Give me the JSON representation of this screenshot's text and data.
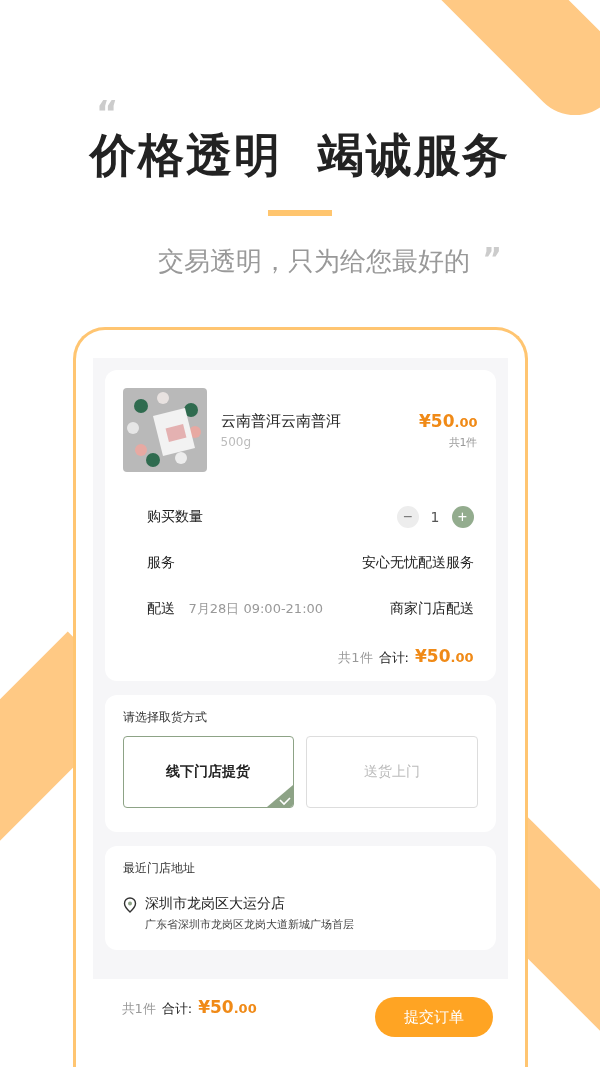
{
  "headline": {
    "open_quote": "“",
    "title": "价格透明  竭诚服务",
    "subtitle": "交易透明，只为给您最好的",
    "close_quote": "”"
  },
  "order": {
    "product": {
      "name": "云南普洱云南普洱",
      "spec": "500g",
      "price": "¥50.00",
      "count": "共1件"
    },
    "quantity": {
      "label": "购买数量",
      "minus": "−",
      "value": "1",
      "plus": "+",
      "minus_disabled": true
    },
    "service": {
      "label": "服务",
      "value": "安心无忧配送服务"
    },
    "delivery": {
      "label": "配送",
      "time": "7月28日 09:00-21:00",
      "value": "商家门店配送"
    },
    "summary": {
      "count": "共1件",
      "label": "合计:",
      "total": "¥50.00"
    }
  },
  "pickup": {
    "title": "请选择取货方式",
    "options": [
      {
        "label": "线下门店提货",
        "selected": true
      },
      {
        "label": "送货上门",
        "selected": false
      }
    ]
  },
  "store": {
    "title": "最近门店地址",
    "name": "深圳市龙岗区大运分店",
    "address": "广东省深圳市龙岗区龙岗大道新城广场首层"
  },
  "footer": {
    "count": "共1件",
    "label": "合计:",
    "total": "¥50.00",
    "submit": "提交订单"
  }
}
